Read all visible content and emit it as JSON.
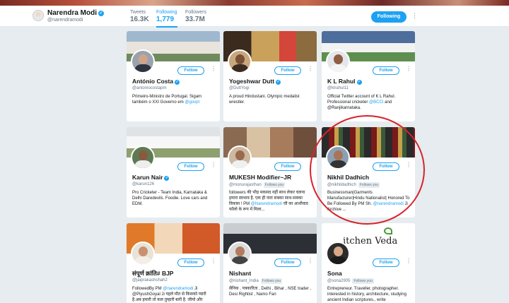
{
  "profile": {
    "name": "Narendra Modi",
    "handle": "@narendramodi",
    "verified_mark": "✓",
    "stats": [
      {
        "label": "Tweets",
        "value": "16.3K"
      },
      {
        "label": "Following",
        "value": "1,779"
      },
      {
        "label": "Followers",
        "value": "33.7M"
      }
    ],
    "following_label": "Following",
    "more": "⋮"
  },
  "colors": {
    "accent": "#1da1f2",
    "background": "#e6ecf0",
    "annotation": "#d8232a"
  },
  "follow_label": "Follow",
  "follows_you_label": "Follows you",
  "cards": [
    {
      "name": "António Costa",
      "verified": true,
      "handle": "@antoniocostapm",
      "follows_you": false,
      "bio": "Primeiro-Ministro de Portugal. Sigam também o XXI Governo em ",
      "bio_link": "@govpt",
      "bio_after": ""
    },
    {
      "name": "Yogeshwar Dutt",
      "verified": true,
      "handle": "@DuttYogi",
      "follows_you": false,
      "bio": "A proud Hindustani. Olympic medalist wrestler.",
      "bio_link": "",
      "bio_after": ""
    },
    {
      "name": "K L Rahul",
      "verified": true,
      "handle": "@klrahul11",
      "follows_you": false,
      "bio": "Official Twitter account of K L Rahul. Professional cricketer ",
      "bio_link": "@BCCI",
      "bio_after": " and @Ranjikarnataka."
    },
    {
      "name": "Karun Nair",
      "verified": true,
      "handle": "@karun126",
      "follows_you": false,
      "bio": "Pro Cricketer - Team India, Karnataka & Delhi Daredevils. Foodie. Love cars and EDM.",
      "bio_link": "",
      "bio_after": ""
    },
    {
      "name": "MUKESH Modifier~JR",
      "verified": false,
      "handle": "@monurajasthan",
      "follows_you": true,
      "bio": "followers की भीड़ मकसद नहीं साथ लेकर चलना हमारा स्वभाव है. एक ही नारा सबका साथ-सबका विकास ! PM ",
      "bio_link": "@Narendramodi",
      "bio_after": " जी का आशीवाद फॉलो के रूप में मिला..."
    },
    {
      "name": "Nikhil Dadhich",
      "verified": false,
      "handle": "@nikhildadhich",
      "follows_you": true,
      "bio": "Businessman|Garments Manufacturer|Hindu Nationalist| Honored To Be Followed By PM Sh. ",
      "bio_link": "@narendramodi",
      "bio_after": " Ji Archive ..."
    },
    {
      "name": "संपूर्ण क्रांति# BJP",
      "verified": false,
      "handle": "@jaiprakashshah2",
      "follows_you": false,
      "bio": "FollowedBy PM ",
      "bio_link": "@narendramodi",
      "bio_after": " Ji @PiyushGoyal Ji पहले मौत से किसको प्यारी है.अब हमारी तो कल तुम्हारी बारी है. जीयो और"
    },
    {
      "name": "Nishant",
      "verified": false,
      "handle": "@nishant_India",
      "follows_you": true,
      "bio": "सैनिक , पत्रकारिता , Delhi , Bihar , NSE trader , Desi Rightist , Namo Fan",
      "bio_link": "",
      "bio_after": ""
    },
    {
      "name": "Sona",
      "verified": false,
      "handle": "@sona2905",
      "follows_you": true,
      "bio": "Entrepreneur. Traveller, photographer. interested in history, architecture, studying ancient Indian scriptures., write",
      "bio_link": "",
      "bio_after": ""
    }
  ],
  "logo_text": "itchen Veda"
}
